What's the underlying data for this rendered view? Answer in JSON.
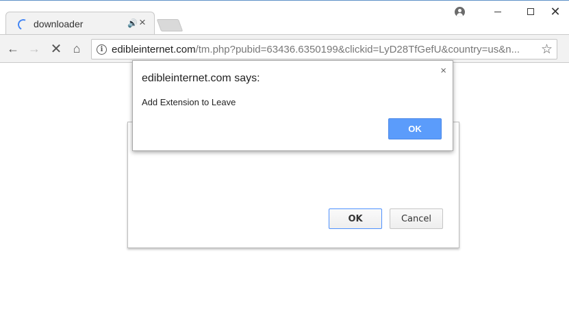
{
  "tab": {
    "title": "downloader",
    "audio_glyph": "🔊",
    "close_glyph": "×"
  },
  "window_controls": {
    "minimize": "minimize",
    "maximize": "maximize",
    "close_glyph": "✕"
  },
  "toolbar": {
    "back_glyph": "←",
    "forward_glyph": "→",
    "stop_glyph": "✕",
    "home_glyph": "⌂",
    "star_glyph": "☆",
    "info_glyph": "i",
    "url_host": "edibleinternet.com",
    "url_rest": "/tm.php?pubid=63436.6350199&clickid=LyD28TfGefU&country=us&n..."
  },
  "back_dialog": {
    "ok_label": "OK",
    "cancel_label": "Cancel"
  },
  "alert": {
    "title": "edibleinternet.com says:",
    "message": "Add Extension to Leave",
    "ok_label": "OK",
    "close_glyph": "×"
  },
  "colors": {
    "accent": "#5b9cfb",
    "spinner": "#4285f4"
  }
}
